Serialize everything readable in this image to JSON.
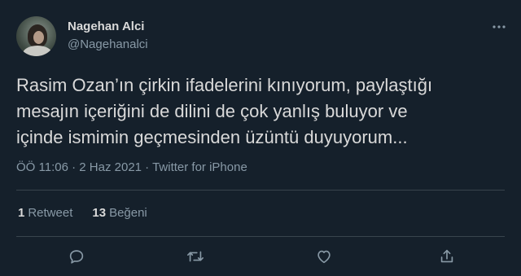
{
  "author": {
    "name": "Nagehan Alci",
    "handle": "@Nagehanalci"
  },
  "tweet": {
    "text": "Rasim Ozan’ın çirkin ifadelerini kınıyorum, paylaştığı\nmesajın içeriğini de dilini de çok yanlış buluyor ve\niçinde ismimin geçmesinden üzüntü duyuyorum...",
    "time": "ÖÖ 11:06",
    "date": "2 Haz 2021",
    "source": "Twitter for iPhone",
    "separator": " · "
  },
  "stats": {
    "retweets_count": "1",
    "retweets_label": "Retweet",
    "likes_count": "13",
    "likes_label": "Beğeni"
  },
  "icons": {
    "more": "more-icon",
    "reply": "reply-icon",
    "retweet": "retweet-icon",
    "like": "like-icon",
    "share": "share-icon"
  },
  "colors": {
    "background": "#15202b",
    "text": "#d9d9d9",
    "secondary": "#8899a6",
    "divider": "#38444d"
  }
}
